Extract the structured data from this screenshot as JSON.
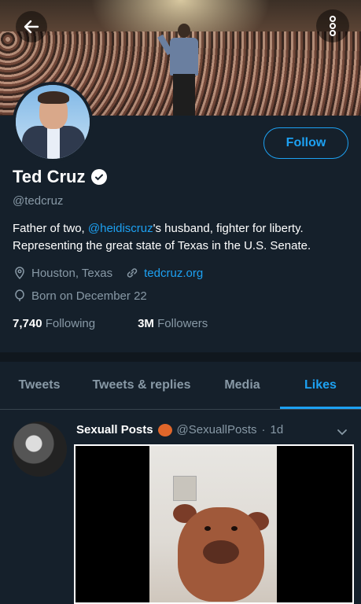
{
  "banner": {
    "description_alt": ""
  },
  "profile": {
    "follow_label": "Follow",
    "name": "Ted Cruz",
    "handle": "@tedcruz",
    "bio_part1": "Father of two, ",
    "bio_mention": "@heidiscruz",
    "bio_part2": "'s husband, fighter for liberty. Representing the great state of Texas in the U.S. Senate.",
    "location": "Houston, Texas",
    "website": "tedcruz.org",
    "born": "Born on December 22",
    "following_count": "7,740",
    "following_label": "Following",
    "followers_count": "3M",
    "followers_label": "Followers"
  },
  "tabs": [
    {
      "label": "Tweets"
    },
    {
      "label": "Tweets & replies"
    },
    {
      "label": "Media"
    },
    {
      "label": "Likes"
    }
  ],
  "tweet": {
    "user_name": "Sexuall Posts",
    "user_handle": "@SexuallPosts",
    "separator": "·",
    "time": "1d"
  },
  "colors": {
    "background": "#15202b",
    "accent": "#1da1f2",
    "secondary_text": "#8899a6"
  }
}
